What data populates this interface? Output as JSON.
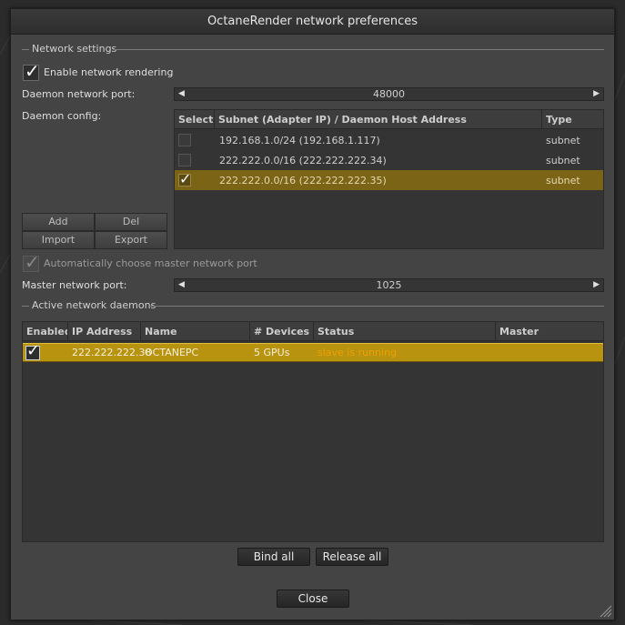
{
  "window": {
    "title": "OctaneRender network preferences"
  },
  "network_settings": {
    "section_label": "Network settings",
    "enable_rendering_label": "Enable network rendering",
    "enable_rendering_checked": true,
    "daemon_port_label": "Daemon network port:",
    "daemon_port_value": "48000",
    "daemon_config_label": "Daemon config:",
    "config_table": {
      "headers": [
        "Select",
        "Subnet (Adapter IP) / Daemon Host Address",
        "Type"
      ],
      "rows": [
        {
          "selected": false,
          "subnet": "192.168.1.0/24 (192.168.1.117)",
          "type": "subnet"
        },
        {
          "selected": false,
          "subnet": "222.222.0.0/16 (222.222.222.34)",
          "type": "subnet"
        },
        {
          "selected": true,
          "subnet": "222.222.0.0/16 (222.222.222.35)",
          "type": "subnet"
        }
      ]
    },
    "buttons": {
      "add": "Add",
      "del": "Del",
      "import": "Import",
      "export": "Export"
    },
    "auto_master_label": "Automatically choose master network port",
    "auto_master_checked": true,
    "master_port_label": "Master network port:",
    "master_port_value": "1025"
  },
  "active_daemons": {
    "section_label": "Active network daemons",
    "headers": [
      "Enabled",
      "IP Address",
      "Name",
      "# Devices",
      "Status",
      "Master"
    ],
    "rows": [
      {
        "enabled": true,
        "ip": "222.222.222.38",
        "name": "OCTANEPC",
        "devices": "5 GPUs",
        "status": "slave is running",
        "master": ""
      }
    ],
    "status_color": "#f0a000"
  },
  "footer": {
    "bind_all": "Bind all",
    "release_all": "Release all",
    "close": "Close"
  },
  "colors": {
    "selection": "#b8930f",
    "selection_dim": "#7c6416"
  }
}
